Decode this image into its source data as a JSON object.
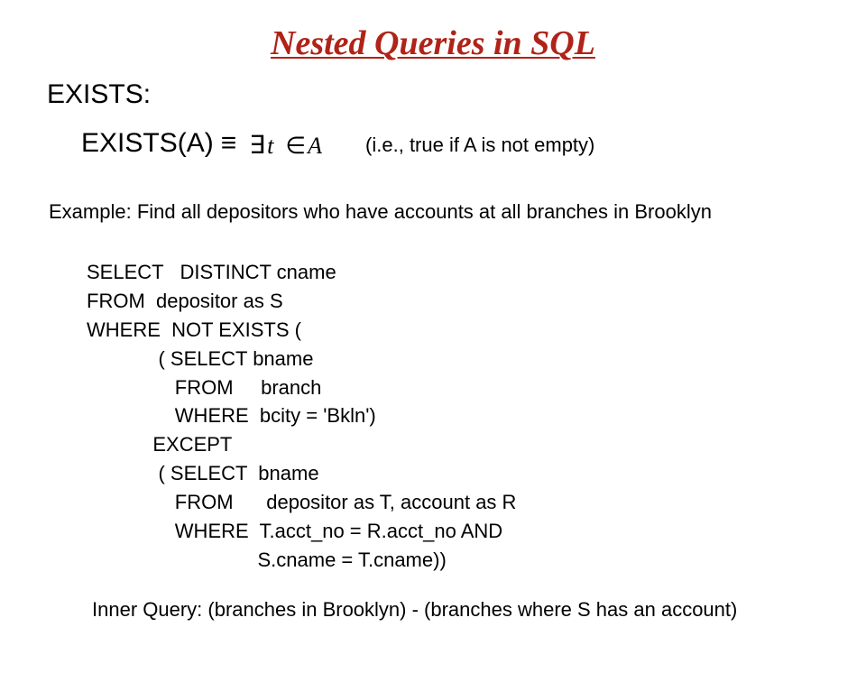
{
  "title": "Nested Queries in SQL",
  "exists_label": "EXISTS:",
  "definition": {
    "lhs": "EXISTS(A)",
    "equiv": "≡",
    "math_exists": "∃",
    "math_t": "t",
    "math_in": "∈",
    "math_A": "A",
    "note": "(i.e., true if A is not empty)"
  },
  "example": "Example:  Find all depositors who have accounts at all branches in Brooklyn",
  "sql": "SELECT   DISTINCT cname\nFROM  depositor as S\nWHERE  NOT EXISTS (\n             ( SELECT bname\n                FROM     branch\n                WHERE  bcity = 'Bkln')\n            EXCEPT\n             ( SELECT  bname\n                FROM      depositor as T, account as R\n                WHERE  T.acct_no = R.acct_no AND\n                               S.cname = T.cname))",
  "inner_query_note": "Inner Query:  (branches in Brooklyn) - (branches where S has an account)"
}
